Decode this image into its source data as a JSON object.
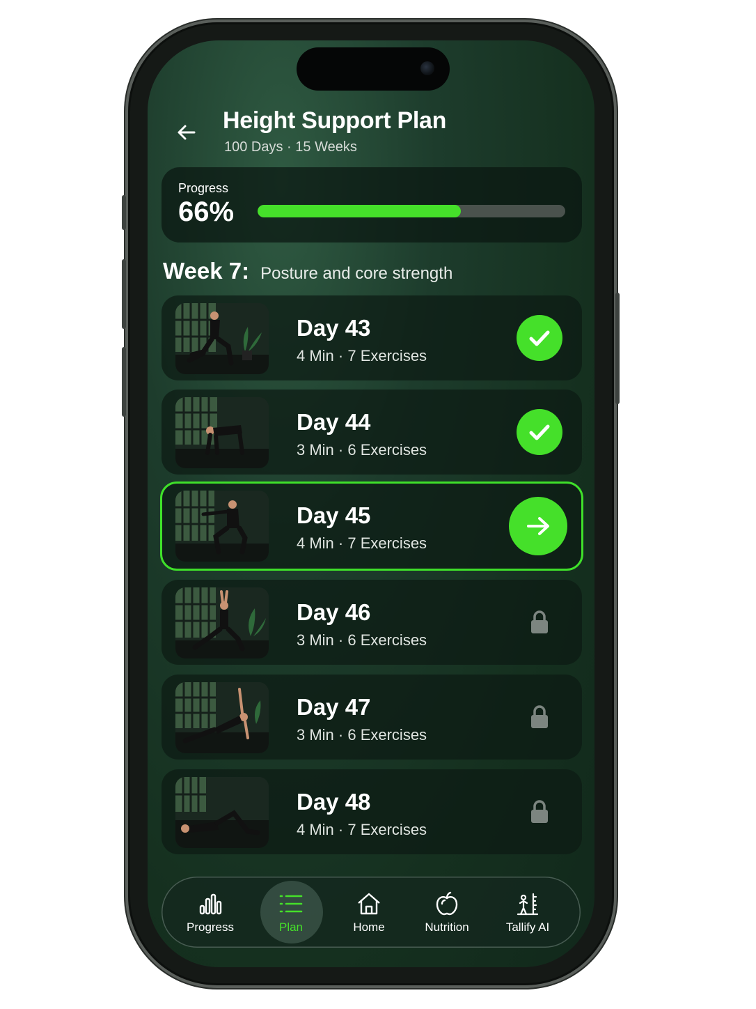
{
  "header": {
    "title": "Height Support Plan",
    "subtitle": "100 Days · 15 Weeks",
    "back_icon": "arrow-left-icon"
  },
  "progress": {
    "label": "Progress",
    "value_text": "66%",
    "fraction": 0.66
  },
  "week": {
    "number_label": "Week 7:",
    "theme": "Posture and core strength"
  },
  "days": [
    {
      "title": "Day 43",
      "meta": "4 Min · 7 Exercises",
      "status": "completed",
      "status_icon": "check-icon"
    },
    {
      "title": "Day 44",
      "meta": "3 Min · 6 Exercises",
      "status": "completed",
      "status_icon": "check-icon"
    },
    {
      "title": "Day 45",
      "meta": "4 Min · 7 Exercises",
      "status": "current",
      "status_icon": "arrow-right-icon"
    },
    {
      "title": "Day 46",
      "meta": "3 Min · 6 Exercises",
      "status": "locked",
      "status_icon": "lock-icon"
    },
    {
      "title": "Day 47",
      "meta": "3 Min · 6 Exercises",
      "status": "locked",
      "status_icon": "lock-icon"
    },
    {
      "title": "Day 48",
      "meta": "4 Min · 7 Exercises",
      "status": "locked",
      "status_icon": "lock-icon"
    }
  ],
  "nav": {
    "items": [
      {
        "label": "Progress",
        "icon": "bar-chart-icon"
      },
      {
        "label": "Plan",
        "icon": "list-icon",
        "active": true
      },
      {
        "label": "Home",
        "icon": "home-icon"
      },
      {
        "label": "Nutrition",
        "icon": "apple-icon"
      },
      {
        "label": "Tallify AI",
        "icon": "height-chart-icon"
      }
    ]
  },
  "colors": {
    "accent": "#45e02a",
    "background": "#1d3c2c",
    "card": "#0c1a13"
  }
}
